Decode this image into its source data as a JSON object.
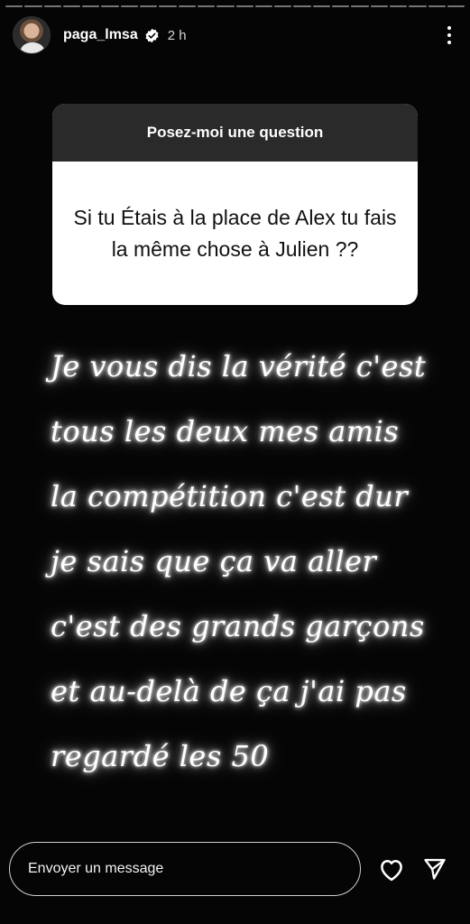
{
  "story": {
    "username": "paga_lmsa",
    "time": "2 h",
    "progress_segments": 24,
    "progress_filled": 0,
    "icons": {
      "verified": "verified-badge-icon",
      "more": "more-vertical-icon",
      "like": "heart-icon",
      "share": "send-icon"
    }
  },
  "question_sticker": {
    "prompt": "Posez-moi une question",
    "question": "Si tu Étais à la place de Alex tu fais la même chose à Julien ??",
    "colors": {
      "header": "#2a2a2a",
      "body": "#ffffff"
    }
  },
  "answer": {
    "text": "Je vous dis la vérité c'est tous les deux mes amis la compétition c'est dur je sais que ça va aller c'est des grands garçons et au-delà de ça j'ai pas regardé les 50"
  },
  "reply": {
    "placeholder": "Envoyer un message"
  }
}
